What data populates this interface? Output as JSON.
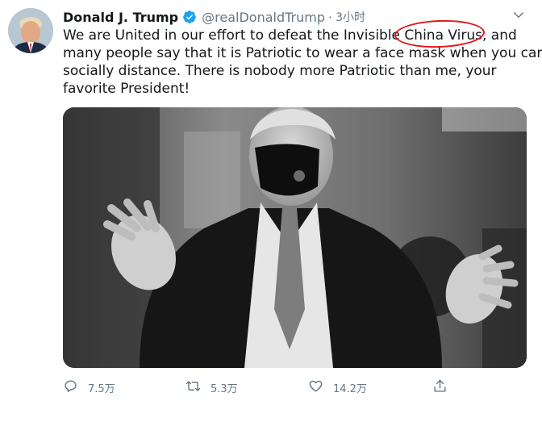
{
  "author": {
    "name": "Donald J. Trump",
    "handle": "@realDonaldTrump",
    "separator": "·",
    "time": "3小时",
    "verified_icon": "verified-badge-icon",
    "avatar_icon": "user-avatar"
  },
  "menu": {
    "icon": "chevron-down-icon"
  },
  "tweet": {
    "line1_before": "We are United in our effort to defeat the Invisible ",
    "line1_circled": "China Virus,",
    "line1_after": " and",
    "line2": "many people say that it is Patriotic to wear a face mask when you can’t",
    "line3": "socially distance. There is nobody more Patriotic than me, your",
    "line4": "favorite President!"
  },
  "media": {
    "icon": "photo-media"
  },
  "actions": {
    "reply": {
      "icon": "reply-icon",
      "count": "7.5万"
    },
    "retweet": {
      "icon": "retweet-icon",
      "count": "5.3万"
    },
    "like": {
      "icon": "heart-icon",
      "count": "14.2万"
    },
    "share": {
      "icon": "share-icon"
    }
  },
  "colors": {
    "text": "#14171a",
    "secondary": "#657786",
    "verified_blue": "#1da1f2",
    "annotation_red": "#e0161b"
  }
}
